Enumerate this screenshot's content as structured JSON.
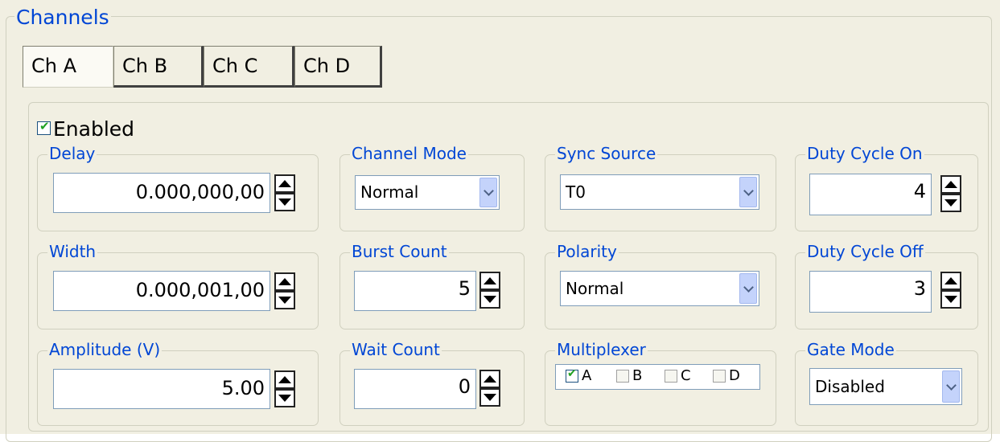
{
  "channels_group": {
    "title": "Channels",
    "tabs": [
      {
        "label": "Ch A",
        "active": true
      },
      {
        "label": "Ch B",
        "active": false
      },
      {
        "label": "Ch C",
        "active": false
      },
      {
        "label": "Ch D",
        "active": false
      }
    ]
  },
  "enabled": {
    "label": "Enabled",
    "checked": true
  },
  "delay": {
    "label": "Delay",
    "value": "0.000,000,00"
  },
  "width": {
    "label": "Width",
    "value": "0.000,001,00"
  },
  "amplitude": {
    "label": "Amplitude (V)",
    "value": "5.00"
  },
  "channel_mode": {
    "label": "Channel Mode",
    "value": "Normal"
  },
  "burst_count": {
    "label": "Burst Count",
    "value": "5"
  },
  "wait_count": {
    "label": "Wait Count",
    "value": "0"
  },
  "sync_source": {
    "label": "Sync Source",
    "value": "T0"
  },
  "polarity": {
    "label": "Polarity",
    "value": "Normal"
  },
  "multiplexer": {
    "label": "Multiplexer",
    "options": [
      {
        "label": "A",
        "checked": true
      },
      {
        "label": "B",
        "checked": false
      },
      {
        "label": "C",
        "checked": false
      },
      {
        "label": "D",
        "checked": false
      }
    ]
  },
  "duty_cycle_on": {
    "label": "Duty Cycle On",
    "value": "4"
  },
  "duty_cycle_off": {
    "label": "Duty Cycle Off",
    "value": "3"
  },
  "gate_mode": {
    "label": "Gate Mode",
    "value": "Disabled"
  },
  "colors": {
    "legend_text": "#0046d5",
    "panel_bg": "#f1efe2",
    "check_green": "#21a121",
    "dropdown_button": "#c4d3fb"
  },
  "icons": {
    "spin_up": "triangle-up-icon",
    "spin_down": "triangle-down-icon",
    "dropdown": "chevron-down-icon",
    "check": "checkmark-icon"
  }
}
